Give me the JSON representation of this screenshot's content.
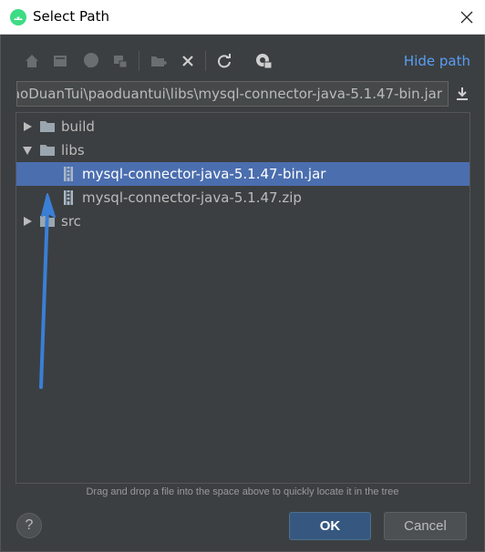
{
  "window": {
    "title": "Select Path"
  },
  "toolbar": {
    "icons": [
      "home-icon",
      "desktop-icon",
      "project-icon",
      "module-icon",
      "new-folder-icon",
      "delete-icon",
      "refresh-icon",
      "show-hidden-icon"
    ],
    "hide_path_label": "Hide path"
  },
  "path": {
    "value": "aoDuanTui\\paoduantui\\libs\\mysql-connector-java-5.1.47-bin.jar"
  },
  "tree": {
    "items": [
      {
        "label": "build",
        "type": "folder",
        "expanded": false
      },
      {
        "label": "libs",
        "type": "folder",
        "expanded": true
      },
      {
        "label": "mysql-connector-java-5.1.47-bin.jar",
        "type": "jar",
        "selected": true
      },
      {
        "label": "mysql-connector-java-5.1.47.zip",
        "type": "zip",
        "selected": false
      },
      {
        "label": "src",
        "type": "folder",
        "expanded": false
      }
    ]
  },
  "hint": "Drag and drop a file into the space above to quickly locate it in the tree",
  "buttons": {
    "help": "?",
    "ok": "OK",
    "cancel": "Cancel"
  },
  "colors": {
    "accent": "#589df6",
    "selection": "#4b6eaf",
    "annotation": "#3a7fd6"
  }
}
